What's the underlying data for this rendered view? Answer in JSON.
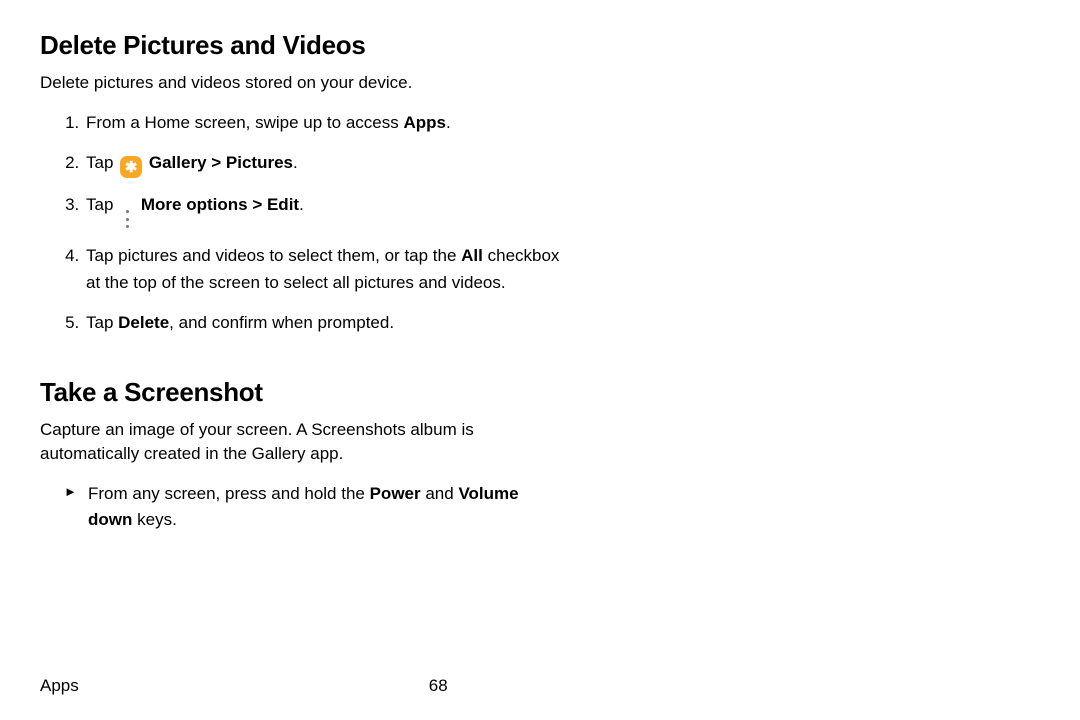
{
  "sections": {
    "delete": {
      "heading": "Delete Pictures and Videos",
      "intro": "Delete pictures and videos stored on your device.",
      "steps": {
        "s1": {
          "pre": "From a Home screen, swipe up to access ",
          "apps": "Apps",
          "post": "."
        },
        "s2": {
          "pre": "Tap ",
          "gallery": "Gallery",
          "chevron": " > ",
          "pictures": "Pictures",
          "post": "."
        },
        "s3": {
          "pre": "Tap ",
          "more": "More options",
          "chevron": " > ",
          "edit": "Edit",
          "post": "."
        },
        "s4": {
          "pre": "Tap pictures and videos to select them, or tap the ",
          "all": "All",
          "mid": " checkbox at the top of the screen to select all pictures and videos."
        },
        "s5": {
          "pre": "Tap ",
          "delete": "Delete",
          "post": ", and confirm when prompted."
        }
      }
    },
    "screenshot": {
      "heading": "Take a Screenshot",
      "intro": "Capture an image of your screen. A Screenshots album is automatically created in the Gallery app.",
      "step": {
        "pre": "From any screen, press and hold the ",
        "power": "Power",
        "mid": " and ",
        "voldown": "Volume down",
        "post": " keys."
      }
    }
  },
  "footer": {
    "section": "Apps",
    "page": "68"
  },
  "icons": {
    "gallery_glyph": "✱"
  }
}
